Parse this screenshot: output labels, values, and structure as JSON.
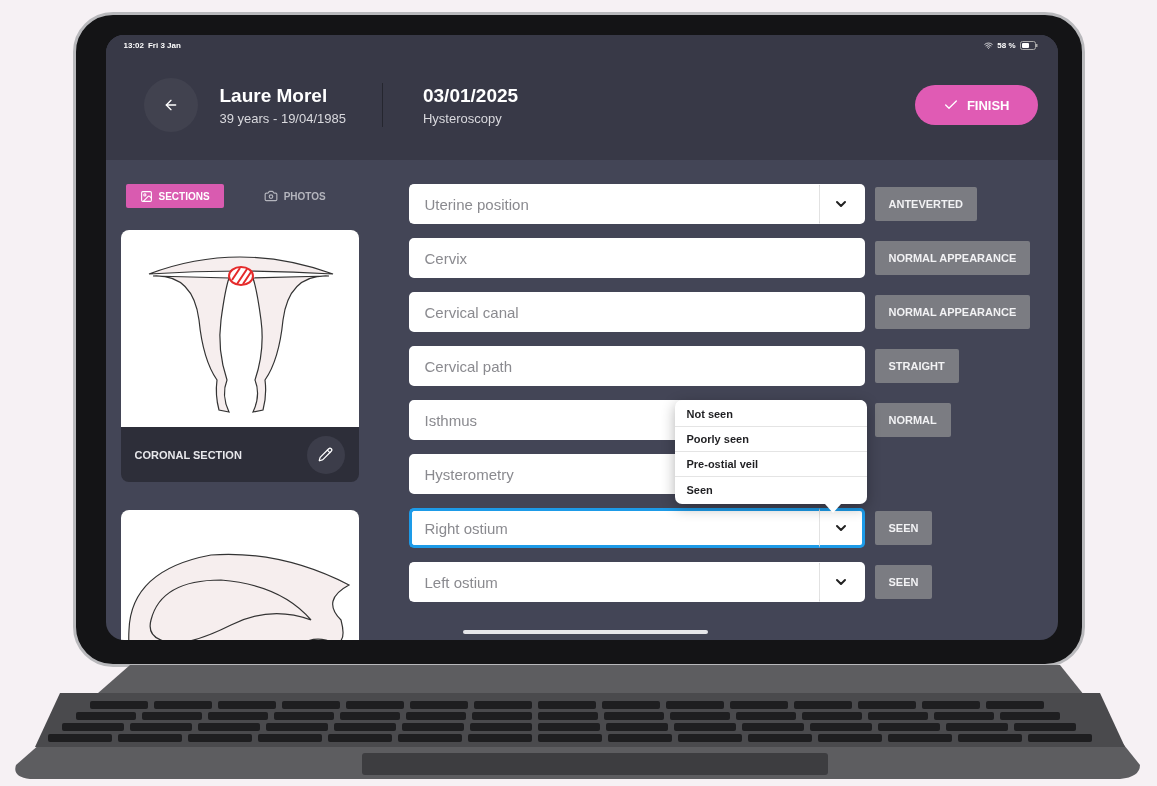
{
  "status_bar": {
    "time": "13:02",
    "date": "Fri 3 Jan",
    "battery": "58 %"
  },
  "header": {
    "patient_name": "Laure Morel",
    "patient_details": "39 years - 19/04/1985",
    "date": "03/01/2025",
    "procedure": "Hysteroscopy",
    "finish_button": "FINISH"
  },
  "view_tabs": [
    {
      "label": "SECTIONS",
      "selected": true
    },
    {
      "label": "PHOTOS",
      "selected": false
    }
  ],
  "section_cards": [
    {
      "kind": "coronal",
      "label": "CORONAL SECTION"
    },
    {
      "kind": "sagittal"
    }
  ],
  "fields": [
    {
      "placeholder": "Uterine position",
      "dropdown": true,
      "focused": false,
      "tag": "ANTEVERTED"
    },
    {
      "placeholder": "Cervix",
      "dropdown": false,
      "focused": false,
      "tag": "NORMAL APPEARANCE"
    },
    {
      "placeholder": "Cervical canal",
      "dropdown": false,
      "focused": false,
      "tag": "NORMAL APPEARANCE"
    },
    {
      "placeholder": "Cervical path",
      "dropdown": false,
      "focused": false,
      "tag": "STRAIGHT"
    },
    {
      "placeholder": "Isthmus",
      "dropdown": false,
      "focused": false,
      "tag": "NORMAL"
    },
    {
      "placeholder": "Hysterometry",
      "dropdown": false,
      "focused": false
    },
    {
      "placeholder": "Right ostium",
      "dropdown": true,
      "focused": true,
      "tag": "SEEN"
    },
    {
      "placeholder": "Left ostium",
      "dropdown": true,
      "focused": false,
      "tag": "SEEN"
    }
  ],
  "dropdown_menu": {
    "items": [
      "Not seen",
      "Poorly seen",
      "Pre-ostial veil",
      "Seen"
    ]
  }
}
